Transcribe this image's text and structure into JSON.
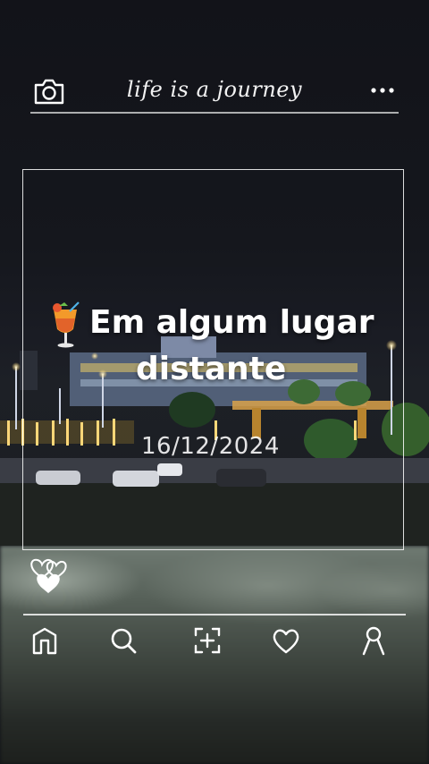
{
  "header": {
    "title": "life is a journey",
    "camera_icon": "camera-icon",
    "more_icon": "more-dots-icon"
  },
  "post": {
    "emoji_icon": "tropical-drink-icon",
    "caption_line1": "Em algum lugar",
    "caption_line2": "distante",
    "date": "16/12/2024"
  },
  "reactions": {
    "icon": "hearts-icon"
  },
  "nav": {
    "items": [
      {
        "name": "home",
        "icon": "home-icon"
      },
      {
        "name": "search",
        "icon": "search-icon"
      },
      {
        "name": "scan",
        "icon": "scan-plus-icon"
      },
      {
        "name": "likes",
        "icon": "heart-icon"
      },
      {
        "name": "profile",
        "icon": "profile-icon"
      }
    ]
  },
  "colors": {
    "background": "#0f1116",
    "foreground": "#ffffff"
  }
}
